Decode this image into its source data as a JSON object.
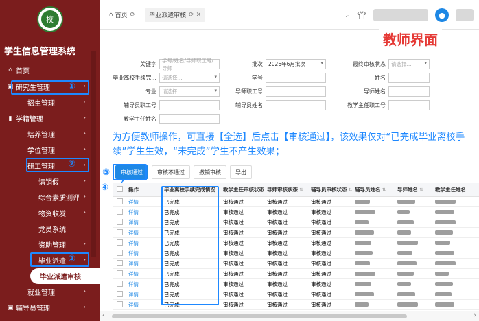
{
  "sidebar": {
    "logo_text": "校",
    "system_title": "学生信息管理系统",
    "items": [
      {
        "label": "首页",
        "icon": "home-icon",
        "level": 1,
        "chevron": false
      },
      {
        "label": "研究生管理",
        "icon": "grid-icon",
        "level": 1,
        "chevron": true
      },
      {
        "label": "招生管理",
        "icon": "",
        "level": 2,
        "chevron": true
      },
      {
        "label": "学籍管理",
        "icon": "bars-icon",
        "level": 1,
        "chevron": true
      },
      {
        "label": "培养管理",
        "icon": "",
        "level": 2,
        "chevron": true
      },
      {
        "label": "学位管理",
        "icon": "",
        "level": 2,
        "chevron": true
      },
      {
        "label": "研工管理",
        "icon": "",
        "level": 2,
        "chevron": true
      },
      {
        "label": "请销假",
        "icon": "",
        "level": 3,
        "chevron": true
      },
      {
        "label": "综合素质测评",
        "icon": "",
        "level": 3,
        "chevron": true
      },
      {
        "label": "物资收发",
        "icon": "",
        "level": 3,
        "chevron": true
      },
      {
        "label": "党员系统",
        "icon": "",
        "level": 3,
        "chevron": false
      },
      {
        "label": "资助管理",
        "icon": "",
        "level": 3,
        "chevron": true
      },
      {
        "label": "毕业派遣",
        "icon": "",
        "level": 3,
        "chevron": true
      },
      {
        "label": "毕业派遣审核",
        "icon": "",
        "level": 4,
        "chevron": false
      },
      {
        "label": "就业管理",
        "icon": "",
        "level": 2,
        "chevron": true
      },
      {
        "label": "辅导员管理",
        "icon": "grid-icon",
        "level": 1,
        "chevron": true
      }
    ],
    "markers": {
      "m1": "①",
      "m2": "②",
      "m3": "③"
    }
  },
  "topbar": {
    "tabs": [
      {
        "label": "首页",
        "icon": "home-icon",
        "close": "⟳"
      },
      {
        "label": "毕业派遣审核",
        "close": "⟳ ✕"
      }
    ]
  },
  "teacher_label": "教师界面",
  "form": {
    "keyword": {
      "label": "关键字",
      "placeholder": "学号/姓名/导师职工号/导师"
    },
    "batch": {
      "label": "批次",
      "value": "2026年6月批次"
    },
    "final_status": {
      "label": "最终审核状态",
      "placeholder": "请选择..."
    },
    "procedure": {
      "label": "毕业离校手续完...",
      "placeholder": "请选择..."
    },
    "student_no": {
      "label": "学号"
    },
    "name": {
      "label": "姓名"
    },
    "major": {
      "label": "专业",
      "placeholder": "请选择..."
    },
    "tutor_id": {
      "label": "导师职工号"
    },
    "tutor_name": {
      "label": "导师姓名"
    },
    "counselor_id": {
      "label": "辅导员职工号"
    },
    "counselor_name": {
      "label": "辅导员姓名"
    },
    "director_id": {
      "label": "教学主任职工号"
    },
    "director_name": {
      "label": "教学主任姓名"
    }
  },
  "note": "为方便教师操作，可直接【全选】后点击【审核通过】，该效果仅对“已完成毕业离校手续”学生生效，“未完成”学生不产生效果；",
  "buttons": {
    "approve": "审核通过",
    "reject": "审核不通过",
    "revoke": "撤销审核",
    "export": "导出",
    "marker5": "⑤",
    "marker4": "④",
    "check": "√"
  },
  "table": {
    "columns": [
      "",
      "操作",
      "毕业离校手续完成情况",
      "教学主任审核状态",
      "导师审核状态",
      "辅导员审核状态",
      "辅导员姓名",
      "导师姓名",
      "教学主任姓名"
    ],
    "rows": [
      {
        "op": "详情",
        "procedure": "已完成",
        "s1": "审核通过",
        "s2": "审核通过",
        "s3": "审核通过"
      },
      {
        "op": "详情",
        "procedure": "已完成",
        "s1": "审核通过",
        "s2": "审核通过",
        "s3": "审核通过"
      },
      {
        "op": "详情",
        "procedure": "已完成",
        "s1": "审核通过",
        "s2": "审核通过",
        "s3": "审核通过"
      },
      {
        "op": "详情",
        "procedure": "已完成",
        "s1": "审核通过",
        "s2": "审核通过",
        "s3": "审核通过"
      },
      {
        "op": "详情",
        "procedure": "已完成",
        "s1": "审核通过",
        "s2": "审核通过",
        "s3": "审核通过"
      },
      {
        "op": "详情",
        "procedure": "已完成",
        "s1": "审核通过",
        "s2": "审核通过",
        "s3": "审核通过"
      },
      {
        "op": "详情",
        "procedure": "已完成",
        "s1": "审核通过",
        "s2": "审核通过",
        "s3": "审核通过"
      },
      {
        "op": "详情",
        "procedure": "已完成",
        "s1": "审核通过",
        "s2": "审核通过",
        "s3": "审核通过"
      },
      {
        "op": "详情",
        "procedure": "已完成",
        "s1": "审核通过",
        "s2": "审核通过",
        "s3": "审核通过"
      },
      {
        "op": "详情",
        "procedure": "已完成",
        "s1": "审核通过",
        "s2": "审核通过",
        "s3": "审核通过"
      },
      {
        "op": "详情",
        "procedure": "已完成",
        "s1": "审核通过",
        "s2": "审核通过",
        "s3": "审核通过"
      }
    ]
  },
  "colors": {
    "sidebar": "#7b1d1d",
    "accent": "#1e88e5",
    "highlight": "#1e88ff",
    "label_red": "#e53935"
  }
}
